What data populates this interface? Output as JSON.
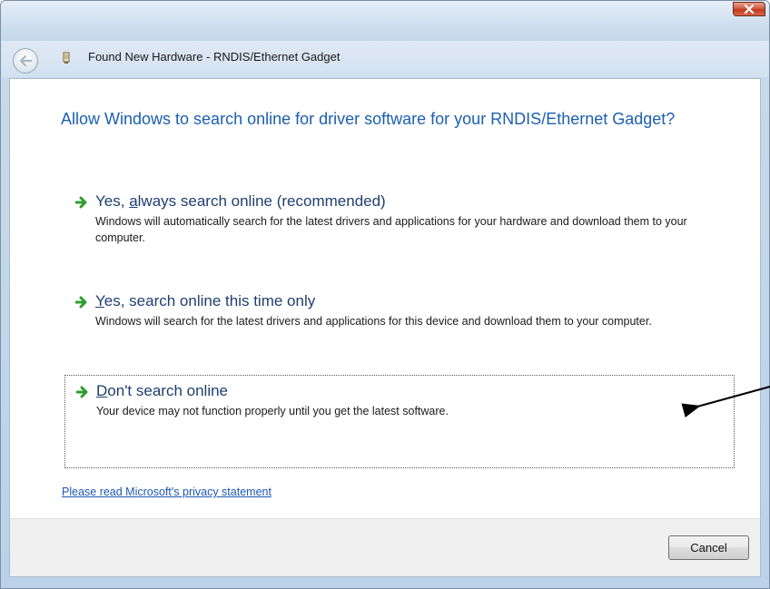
{
  "window": {
    "title": "Found New Hardware - RNDIS/Ethernet Gadget",
    "close_icon": "close-icon",
    "back_icon": "back-arrow-icon",
    "device_icon": "hardware-device-icon"
  },
  "main": {
    "heading": "Allow Windows to search online for driver software for your RNDIS/Ethernet Gadget?",
    "options": [
      {
        "title_pre": "Yes, ",
        "title_accel": "a",
        "title_post": "lways search online (recommended)",
        "description": "Windows will automatically search for the latest drivers and applications for your hardware and download them to your computer.",
        "icon": "green-arrow-icon"
      },
      {
        "title_pre": "",
        "title_accel": "Y",
        "title_post": "es, search online this time only",
        "description": "Windows will search for the latest drivers and applications for this device and download them to your computer.",
        "icon": "green-arrow-icon"
      },
      {
        "title_pre": "",
        "title_accel": "D",
        "title_post": "on't search online",
        "description": "Your device may not function properly until you get the latest software.",
        "icon": "green-arrow-icon",
        "focused": true
      }
    ],
    "privacy_link": "Please read Microsoft's  privacy statement"
  },
  "footer": {
    "cancel_label": "Cancel"
  },
  "colors": {
    "heading": "#1c5fb0",
    "link": "#1e56b4",
    "arrow": "#2e9d2e"
  }
}
